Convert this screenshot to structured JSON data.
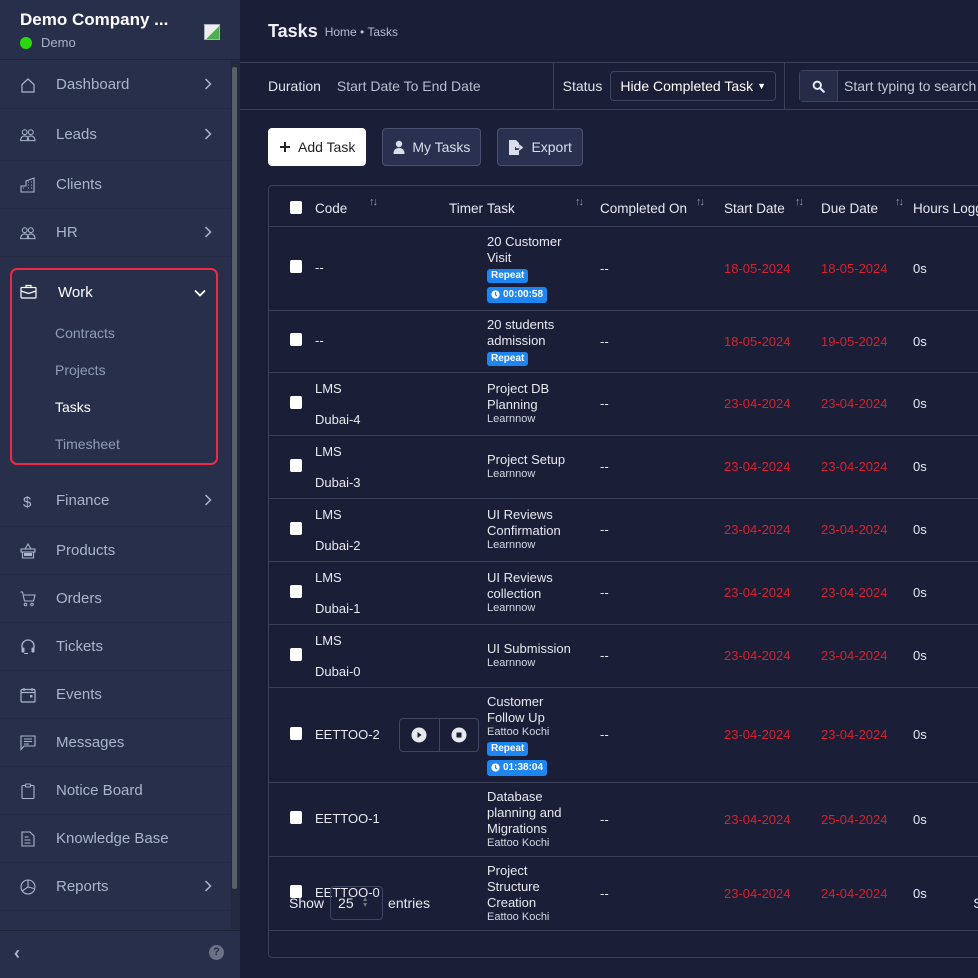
{
  "sidebar": {
    "company": "Demo Company ...",
    "workspace": "Demo",
    "items": [
      {
        "label": "Dashboard",
        "icon": "home-icon",
        "chevron": true
      },
      {
        "label": "Leads",
        "icon": "users-icon",
        "chevron": true
      },
      {
        "label": "Clients",
        "icon": "building-icon",
        "chevron": false
      },
      {
        "label": "HR",
        "icon": "users-icon",
        "chevron": true
      }
    ],
    "work": {
      "label": "Work",
      "sub": [
        "Contracts",
        "Projects",
        "Tasks",
        "Timesheet"
      ],
      "active": "Tasks"
    },
    "items_after": [
      {
        "label": "Finance",
        "icon": "dollar-icon",
        "chevron": true
      },
      {
        "label": "Products",
        "icon": "basket-icon"
      },
      {
        "label": "Orders",
        "icon": "cart-icon"
      },
      {
        "label": "Tickets",
        "icon": "headset-icon"
      },
      {
        "label": "Events",
        "icon": "calendar-icon"
      },
      {
        "label": "Messages",
        "icon": "message-icon"
      },
      {
        "label": "Notice Board",
        "icon": "clipboard-icon"
      },
      {
        "label": "Knowledge Base",
        "icon": "document-icon"
      },
      {
        "label": "Reports",
        "icon": "pie-chart-icon",
        "chevron": true
      }
    ]
  },
  "header": {
    "title": "Tasks",
    "breadcrumb": "Home • Tasks"
  },
  "filters": {
    "duration_label": "Duration",
    "duration_value": "Start Date To End Date",
    "status_label": "Status",
    "status_value": "Hide Completed Task",
    "search_placeholder": "Start typing to search"
  },
  "actions": {
    "add_task": "Add Task",
    "my_tasks": "My Tasks",
    "export": "Export"
  },
  "table": {
    "columns": [
      "Code",
      "Timer",
      "Task",
      "Completed On",
      "Start Date",
      "Due Date",
      "Hours Logged"
    ],
    "rows": [
      {
        "code": [
          "--"
        ],
        "timer": false,
        "task": [
          "20 Customer",
          "Visit"
        ],
        "project": "",
        "repeat": true,
        "running": "00:00:58",
        "completed": "--",
        "start": "18-05-2024",
        "due": "18-05-2024",
        "hours": "0s"
      },
      {
        "code": [
          "--"
        ],
        "timer": false,
        "task": [
          "20 students",
          "admission"
        ],
        "project": "",
        "repeat": true,
        "running": "",
        "completed": "--",
        "start": "18-05-2024",
        "due": "19-05-2024",
        "hours": "0s"
      },
      {
        "code": [
          "LMS",
          "Dubai-4"
        ],
        "timer": false,
        "task": [
          "Project DB",
          "Planning"
        ],
        "project": "Learnnow",
        "repeat": false,
        "running": "",
        "completed": "--",
        "start": "23-04-2024",
        "due": "23-04-2024",
        "hours": "0s"
      },
      {
        "code": [
          "LMS",
          "Dubai-3"
        ],
        "timer": false,
        "task": [
          "Project Setup"
        ],
        "project": "Learnnow",
        "repeat": false,
        "running": "",
        "completed": "--",
        "start": "23-04-2024",
        "due": "23-04-2024",
        "hours": "0s"
      },
      {
        "code": [
          "LMS",
          "Dubai-2"
        ],
        "timer": false,
        "task": [
          "UI Reviews",
          "Confirmation"
        ],
        "project": "Learnnow",
        "repeat": false,
        "running": "",
        "completed": "--",
        "start": "23-04-2024",
        "due": "23-04-2024",
        "hours": "0s"
      },
      {
        "code": [
          "LMS",
          "Dubai-1"
        ],
        "timer": false,
        "task": [
          "UI Reviews",
          "collection"
        ],
        "project": "Learnnow",
        "repeat": false,
        "running": "",
        "completed": "--",
        "start": "23-04-2024",
        "due": "23-04-2024",
        "hours": "0s"
      },
      {
        "code": [
          "LMS",
          "Dubai-0"
        ],
        "timer": false,
        "task": [
          "UI Submission"
        ],
        "project": "Learnnow",
        "repeat": false,
        "running": "",
        "completed": "--",
        "start": "23-04-2024",
        "due": "23-04-2024",
        "hours": "0s"
      },
      {
        "code": [
          "EETTOO-2"
        ],
        "timer": true,
        "task": [
          "Customer",
          "Follow Up"
        ],
        "project": "Eattoo Kochi",
        "repeat": true,
        "running": "01:38:04",
        "completed": "--",
        "start": "23-04-2024",
        "due": "23-04-2024",
        "hours": "0s"
      },
      {
        "code": [
          "EETTOO-1"
        ],
        "timer": false,
        "task": [
          "Database",
          "planning and",
          "Migrations"
        ],
        "project": "Eattoo Kochi",
        "repeat": false,
        "running": "",
        "completed": "--",
        "start": "23-04-2024",
        "due": "25-04-2024",
        "hours": "0s"
      },
      {
        "code": [
          "EETTOO-0"
        ],
        "timer": false,
        "task": [
          "Project",
          "Structure",
          "Creation"
        ],
        "project": "Eattoo Kochi",
        "repeat": false,
        "running": "",
        "completed": "--",
        "start": "23-04-2024",
        "due": "24-04-2024",
        "hours": "0s"
      }
    ],
    "repeat_label": "Repeat"
  },
  "footer": {
    "show_label": "Show",
    "page_length": "25",
    "entries_label": "entries",
    "showing_label": "Showing"
  },
  "colors": {
    "accent": "#1d86f0",
    "overdue": "#d8212e",
    "highlight": "#ee2a45",
    "online": "#2bd90b"
  }
}
